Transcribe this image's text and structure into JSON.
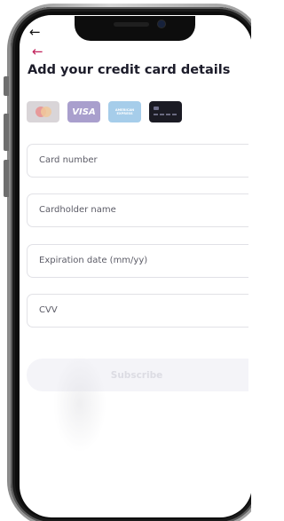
{
  "nav": {
    "top_back_icon": "arrow-left-icon",
    "top_back_glyph": "←",
    "back_icon": "arrow-left-icon",
    "back_glyph": "←",
    "back_color": "#c0205a"
  },
  "page": {
    "title": "Add your credit card details"
  },
  "card_types": [
    {
      "name": "mastercard",
      "label": ""
    },
    {
      "name": "visa",
      "label": "VISA"
    },
    {
      "name": "american-express",
      "label": "AMERICAN EXPRESS"
    },
    {
      "name": "generic-card",
      "label": ""
    }
  ],
  "form": {
    "card_number_placeholder": "Card number",
    "cardholder_name_placeholder": "Cardholder name",
    "expiration_placeholder": "Expiration date (mm/yy)",
    "cvv_placeholder": "CVV",
    "subscribe_label": "Subscribe"
  },
  "colors": {
    "accent": "#c0205a",
    "title": "#1c1c2a",
    "field_border": "#e1e1e6",
    "button_bg": "#f4f4f8",
    "button_text": "#dcdce3"
  }
}
